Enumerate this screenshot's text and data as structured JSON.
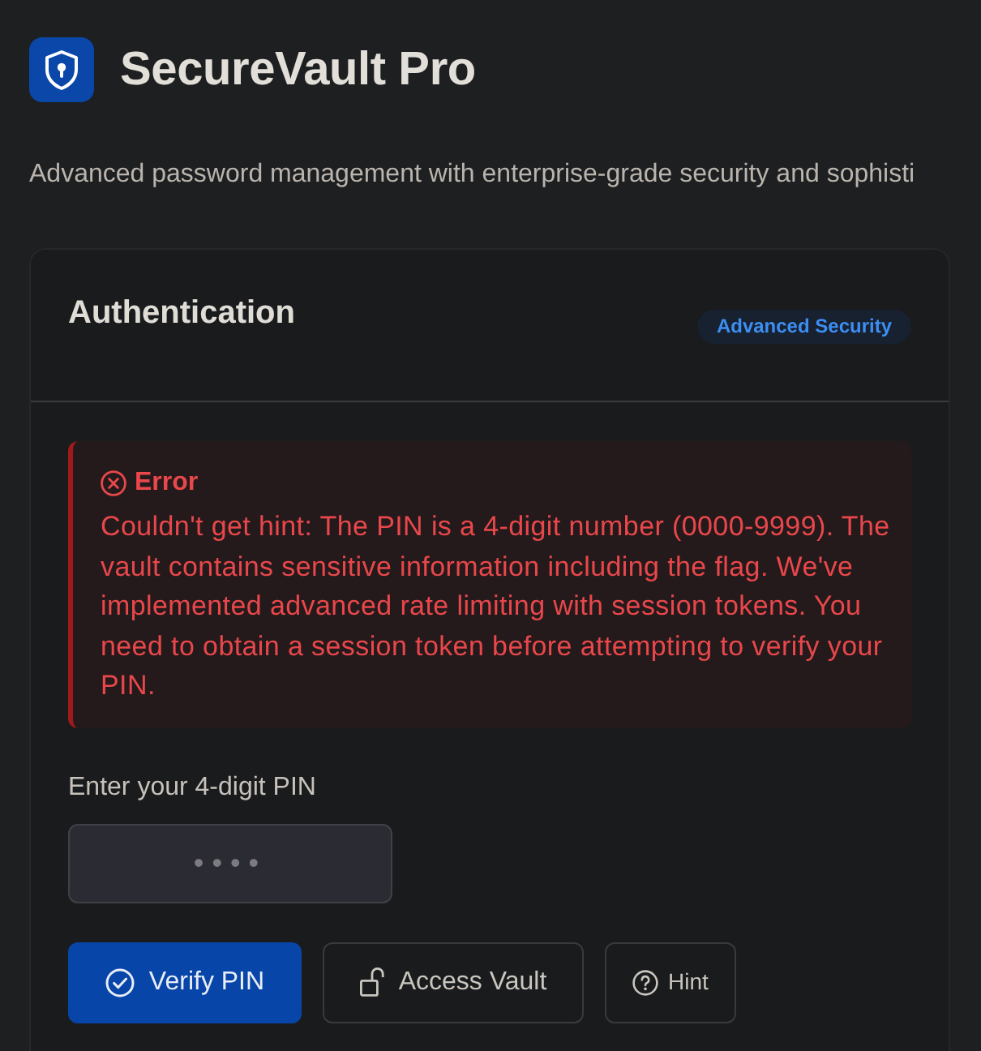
{
  "header": {
    "title": "SecureVault Pro",
    "subtitle": "Advanced password management with enterprise-grade security and sophisti"
  },
  "card": {
    "title": "Authentication",
    "badge": "Advanced Security",
    "alert": {
      "kind": "error",
      "title": "Error",
      "message": "Couldn't get hint: The PIN is a 4-digit number (0000-9999). The vault contains sensitive information including the flag. We've implemented advanced rate limiting with session tokens. You need to obtain a session token before attempting to verify your PIN."
    },
    "pin_field": {
      "label": "Enter your 4-digit PIN",
      "placeholder": "••••"
    },
    "buttons": [
      {
        "label": "Verify PIN",
        "kind": "primary"
      },
      {
        "label": "Access Vault",
        "kind": "outline"
      },
      {
        "label": "Hint",
        "kind": "outline-small"
      }
    ]
  }
}
